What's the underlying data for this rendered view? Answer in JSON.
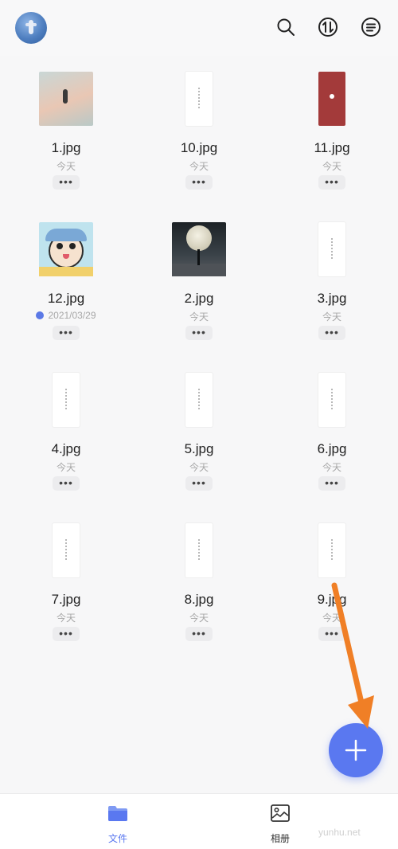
{
  "colors": {
    "accent": "#5a78f0",
    "arrow": "#f07f26",
    "background": "#f7f7f8"
  },
  "files": [
    {
      "name": "1.jpg",
      "date": "今天",
      "thumb": "sky",
      "more": "•••"
    },
    {
      "name": "10.jpg",
      "date": "今天",
      "thumb": "paper",
      "more": "•••"
    },
    {
      "name": "11.jpg",
      "date": "今天",
      "thumb": "red",
      "more": "•••"
    },
    {
      "name": "12.jpg",
      "date": "2021/03/29",
      "thumb": "cartoon",
      "more": "•••",
      "badge": true
    },
    {
      "name": "2.jpg",
      "date": "今天",
      "thumb": "moon",
      "more": "•••"
    },
    {
      "name": "3.jpg",
      "date": "今天",
      "thumb": "paper",
      "more": "•••"
    },
    {
      "name": "4.jpg",
      "date": "今天",
      "thumb": "paper",
      "more": "•••"
    },
    {
      "name": "5.jpg",
      "date": "今天",
      "thumb": "paper",
      "more": "•••"
    },
    {
      "name": "6.jpg",
      "date": "今天",
      "thumb": "paper",
      "more": "•••"
    },
    {
      "name": "7.jpg",
      "date": "今天",
      "thumb": "paper",
      "more": "•••"
    },
    {
      "name": "8.jpg",
      "date": "今天",
      "thumb": "paper",
      "more": "•••"
    },
    {
      "name": "9.jpg",
      "date": "今天",
      "thumb": "paper",
      "more": "•••"
    }
  ],
  "header": {
    "icons": [
      "search-icon",
      "sort-icon",
      "list-menu-icon"
    ]
  },
  "tabs": [
    {
      "label": "文件",
      "icon": "folder-icon",
      "active": true
    },
    {
      "label": "相册",
      "icon": "photo-album-icon",
      "active": false
    }
  ],
  "watermark": "yunhu.net"
}
